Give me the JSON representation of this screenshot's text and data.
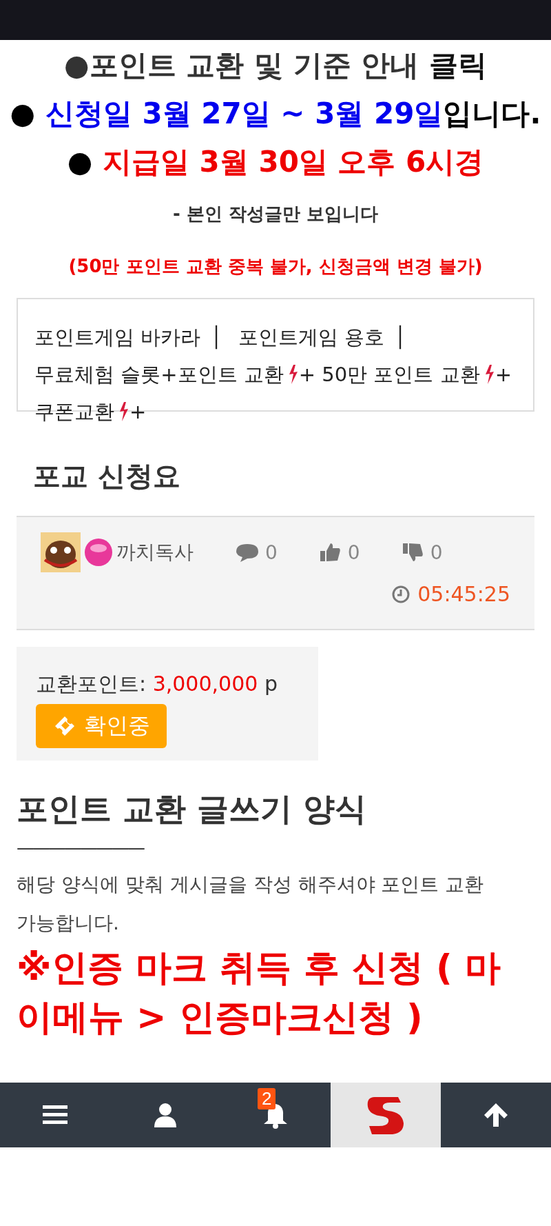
{
  "notice": {
    "lines": [
      {
        "kind": "headline",
        "parts": [
          {
            "text": "●포인트 교환 및 기준 안내 ",
            "color": "#333333"
          },
          {
            "text": "클릭",
            "color": "#111111"
          }
        ]
      },
      {
        "kind": "headline",
        "parts": [
          {
            "text": "● ",
            "color": "#000000"
          },
          {
            "text": "신청일 3월 27일 ~ 3월 29일",
            "color": "#0000ee"
          },
          {
            "text": "입니다.",
            "color": "#000000"
          }
        ]
      },
      {
        "kind": "headline",
        "parts": [
          {
            "text": "● ",
            "color": "#000000"
          },
          {
            "text": "지급일 3월 30일 오후 6시경",
            "color": "#ee0000"
          }
        ]
      },
      {
        "kind": "note",
        "parts": [
          {
            "text": "- 본인 작성글만 보입니다",
            "color": "#333333"
          }
        ]
      },
      {
        "kind": "note",
        "parts": [
          {
            "text": "(50만 포인트 교환 중복 불가, 신청금액 변경 불가)",
            "color": "#ee0000"
          }
        ]
      }
    ]
  },
  "links": [
    {
      "kind": "plain",
      "label": "포인트게임 바카라",
      "separator": "│"
    },
    {
      "kind": "plain",
      "label": "포인트게임 용호",
      "separator": "│"
    },
    {
      "kind": "hot",
      "label": "무료체험 슬롯+포인트 교환",
      "suffix": "+"
    },
    {
      "kind": "hot",
      "label": "50만 포인트 교환",
      "suffix": "+"
    },
    {
      "kind": "hot",
      "label": "쿠폰교환",
      "suffix": "+"
    }
  ],
  "post": {
    "title": "포교 신청요",
    "author": "까치독사",
    "comments": "0",
    "likes": "0",
    "dislikes": "0",
    "time": "05:45:25"
  },
  "points": {
    "label": "교환포인트:",
    "value": "3,000,000",
    "unit": "p",
    "status_button": "확인중"
  },
  "form": {
    "heading": "포인트 교환 글쓰기 양식",
    "rule": "————————",
    "text": "해당 양식에 맞춰 게시글을 작성 해주셔야 포인트 교환 가능합니다.",
    "warning": "※인증 마크 취득 후 신청 ( 마이메뉴 > 인증마크신청 )"
  },
  "bottom_nav": [
    {
      "kind": "menu"
    },
    {
      "kind": "user"
    },
    {
      "kind": "bell",
      "badge": "2"
    },
    {
      "kind": "logo"
    },
    {
      "kind": "top"
    }
  ]
}
